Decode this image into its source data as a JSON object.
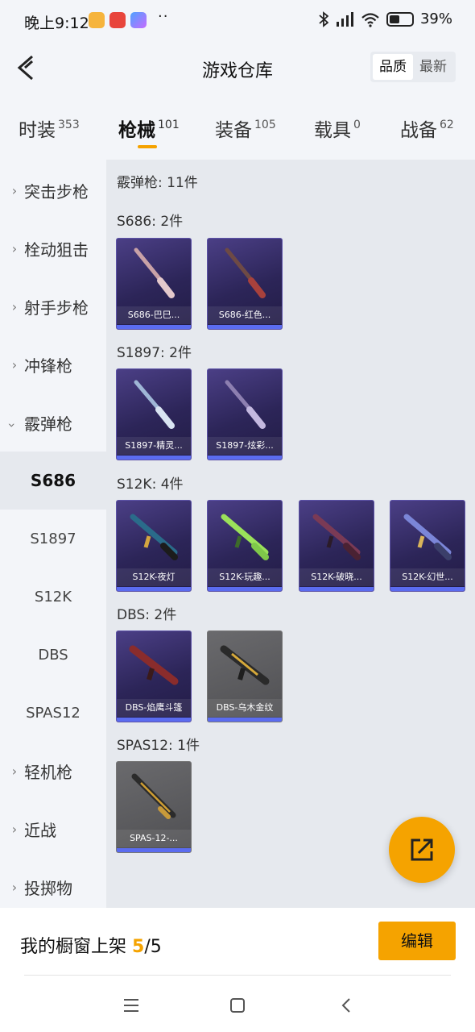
{
  "status_bar": {
    "time": "晚上9:12",
    "dots": "··",
    "battery": "39%"
  },
  "header": {
    "title": "游戏仓库",
    "sort_options": [
      "品质",
      "最新"
    ]
  },
  "tabs": [
    {
      "label": "时装",
      "count": "353"
    },
    {
      "label": "枪械",
      "count": "101"
    },
    {
      "label": "装备",
      "count": "105"
    },
    {
      "label": "载具",
      "count": "0"
    },
    {
      "label": "战备",
      "count": "62"
    }
  ],
  "sidebar": {
    "categories": [
      "突击步枪",
      "栓动狙击",
      "射手步枪",
      "冲锋枪",
      "霰弹枪"
    ],
    "sub_items": [
      "S686",
      "S1897",
      "S12K",
      "DBS",
      "SPAS12"
    ],
    "more": [
      "轻机枪",
      "近战",
      "投掷物"
    ]
  },
  "content": {
    "title": "霰弹枪: 11件",
    "groups": [
      {
        "label": "S686: 2件",
        "items": [
          "S686-巴巳...",
          "S686-红色..."
        ]
      },
      {
        "label": "S1897: 2件",
        "items": [
          "S1897-精灵...",
          "S1897-炫彩..."
        ]
      },
      {
        "label": "S12K: 4件",
        "items": [
          "S12K-夜灯",
          "S12K-玩趣...",
          "S12K-破晓...",
          "S12K-幻世..."
        ]
      },
      {
        "label": "DBS: 2件",
        "items": [
          "DBS-焰鹰斗篷",
          "DBS-乌木金纹"
        ]
      },
      {
        "label": "SPAS12: 1件",
        "items": [
          "SPAS-12-..."
        ]
      }
    ]
  },
  "bottom": {
    "text": "我的橱窗上架 ",
    "current": "5",
    "total": "/5",
    "edit": "编辑"
  }
}
